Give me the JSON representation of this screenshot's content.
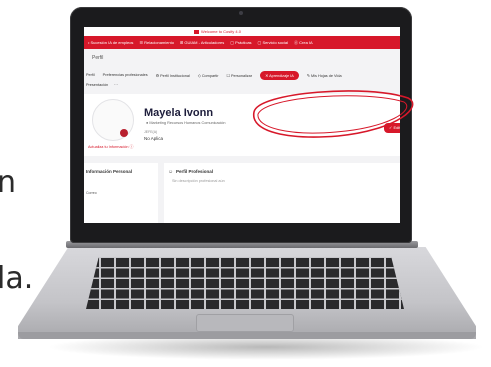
{
  "background": {
    "line1": "n",
    "line2": "la."
  },
  "screen": {
    "welcome": "Welcome to Cosify 4.0",
    "nav": [
      "• Sucesión IA de empleos",
      "☰ Relacionamiento",
      "⊞ GUIAM - Articuladores",
      "▢ Prácticas",
      "▢ Servicio social",
      "ⓖ Crea IA"
    ],
    "breadcrumb": "Perfil",
    "tabs": [
      "Perfil",
      "Preferencias profesionales",
      "⚙ Perfil Institucional",
      "◇ Compartir",
      "☐ Personalizar",
      "✕ Aprendizaje IA",
      "✎ Mis Hojas de Vida"
    ],
    "tabs_row2": [
      "Presentación",
      "···"
    ],
    "profile": {
      "name": "Mayela Ivonn",
      "role": "● Marketing Recursos Humanos Comunicación",
      "jefe_label": "JEFE(A)",
      "jefe_value": "No Aplica",
      "edit_label": "✓ Editar P",
      "update_link": "Actualiza tu Información ⓘ"
    },
    "info_title": "Información Personal",
    "info_sub": "Correo",
    "profile_section_title": "Perfil Profesional",
    "profile_section_desc": "Sin descripción profesional aún"
  },
  "colors": {
    "brand_red": "#d7182a",
    "laptop_frame": "#1b1b1d"
  }
}
